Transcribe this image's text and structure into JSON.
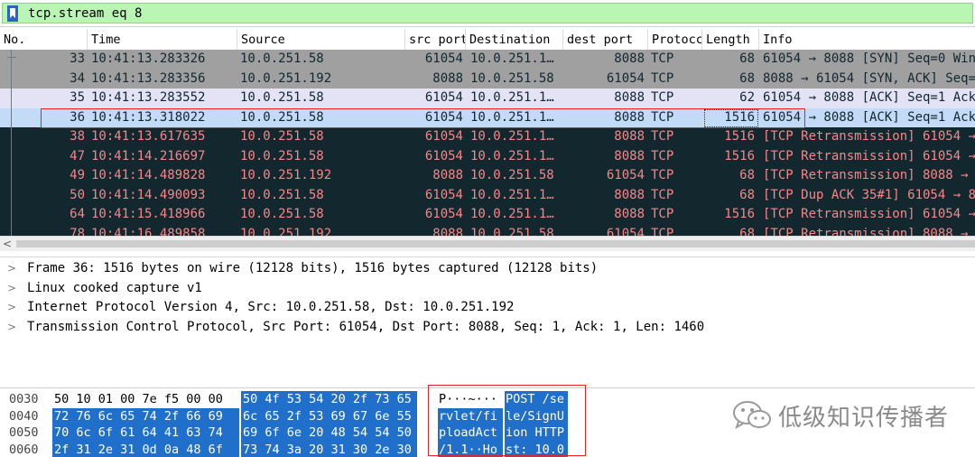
{
  "filter": {
    "expression": "tcp.stream eq 8"
  },
  "columns": [
    "No.",
    "Time",
    "Source",
    "src port",
    "Destination",
    "dest port",
    "Protocc",
    "Length",
    "Info"
  ],
  "packets": [
    {
      "no": "33",
      "time": "10:41:13.283326",
      "src": "10.0.251.58",
      "sport": "61054",
      "dst": "10.0.251.1…",
      "dport": "8088",
      "proto": "TCP",
      "len": "68",
      "info": "61054 → 8088 [SYN] Seq=0 Win="
    },
    {
      "no": "34",
      "time": "10:41:13.283356",
      "src": "10.0.251.192",
      "sport": "8088",
      "dst": "10.0.251.58",
      "dport": "61054",
      "proto": "TCP",
      "len": "68",
      "info": "8088 → 61054 [SYN, ACK] Seq=0"
    },
    {
      "no": "35",
      "time": "10:41:13.283552",
      "src": "10.0.251.58",
      "sport": "61054",
      "dst": "10.0.251.1…",
      "dport": "8088",
      "proto": "TCP",
      "len": "62",
      "info": "61054 → 8088 [ACK] Seq=1 Ack="
    },
    {
      "no": "36",
      "time": "10:41:13.318022",
      "src": "10.0.251.58",
      "sport": "61054",
      "dst": "10.0.251.1…",
      "dport": "8088",
      "proto": "TCP",
      "len": "1516",
      "info": "61054 → 8088 [ACK] Seq=1 Ack="
    },
    {
      "no": "38",
      "time": "10:41:13.617635",
      "src": "10.0.251.58",
      "sport": "61054",
      "dst": "10.0.251.1…",
      "dport": "8088",
      "proto": "TCP",
      "len": "1516",
      "info": "[TCP Retransmission] 61054 →"
    },
    {
      "no": "47",
      "time": "10:41:14.216697",
      "src": "10.0.251.58",
      "sport": "61054",
      "dst": "10.0.251.1…",
      "dport": "8088",
      "proto": "TCP",
      "len": "1516",
      "info": "[TCP Retransmission] 61054 →"
    },
    {
      "no": "49",
      "time": "10:41:14.489828",
      "src": "10.0.251.192",
      "sport": "8088",
      "dst": "10.0.251.58",
      "dport": "61054",
      "proto": "TCP",
      "len": "68",
      "info": "[TCP Retransmission] 8088 → 6"
    },
    {
      "no": "50",
      "time": "10:41:14.490093",
      "src": "10.0.251.58",
      "sport": "61054",
      "dst": "10.0.251.1…",
      "dport": "8088",
      "proto": "TCP",
      "len": "68",
      "info": "[TCP Dup ACK 35#1] 61054 → 80"
    },
    {
      "no": "64",
      "time": "10:41:15.418966",
      "src": "10.0.251.58",
      "sport": "61054",
      "dst": "10.0.251.1…",
      "dport": "8088",
      "proto": "TCP",
      "len": "1516",
      "info": "[TCP Retransmission] 61054 →"
    },
    {
      "no": "78",
      "time": "10:41:16.489858",
      "src": "10.0.251.192",
      "sport": "8088",
      "dst": "10.0.251.58",
      "dport": "61054",
      "proto": "TCP",
      "len": "68",
      "info": "[TCP Retransmission] 8088 → 6"
    }
  ],
  "row_styles": [
    "grey",
    "grey",
    "lav",
    "sel",
    "dark",
    "dark",
    "dark",
    "dark",
    "dark",
    "dark"
  ],
  "details": [
    "Frame 36: 1516 bytes on wire (12128 bits), 1516 bytes captured (12128 bits)",
    "Linux cooked capture v1",
    "Internet Protocol Version 4, Src: 10.0.251.58, Dst: 10.0.251.192",
    "Transmission Control Protocol, Src Port: 61054, Dst Port: 8088, Seq: 1, Ack: 1, Len: 1460"
  ],
  "bytes": [
    {
      "offset": "0030",
      "hex_a": "50 10 01 00 7e f5 00 00",
      "hex_b": "50 4f 53 54 20 2f 73 65",
      "ascii_a": "P···~···",
      "ascii_b": "POST /se",
      "hex_a_sel": false,
      "ascii_a_sel": false
    },
    {
      "offset": "0040",
      "hex_a": "72 76 6c 65 74 2f 66 69",
      "hex_b": "6c 65 2f 53 69 67 6e 55",
      "ascii_a": "rvlet/fi",
      "ascii_b": "le/SignU",
      "hex_a_sel": true,
      "ascii_a_sel": true
    },
    {
      "offset": "0050",
      "hex_a": "70 6c 6f 61 64 41 63 74",
      "hex_b": "69 6f 6e 20 48 54 54 50",
      "ascii_a": "ploadAct",
      "ascii_b": "ion HTTP",
      "hex_a_sel": true,
      "ascii_a_sel": true
    },
    {
      "offset": "0060",
      "hex_a": "2f 31 2e 31 0d 0a 48 6f",
      "hex_b": "73 74 3a 20 31 30 2e 30",
      "ascii_a": "/1.1··Ho",
      "ascii_b": "st: 10.0",
      "hex_a_sel": true,
      "ascii_a_sel": true
    }
  ],
  "watermark": {
    "text": "低级知识传播者"
  },
  "colors": {
    "filter_bg": "#b9f6b4",
    "dark_row_bg": "#12272e",
    "dark_row_fg": "#f78788",
    "selection_bg": "#c3dbf7",
    "byte_highlight": "#1f6fcb",
    "annotation_red": "#e8221f"
  }
}
